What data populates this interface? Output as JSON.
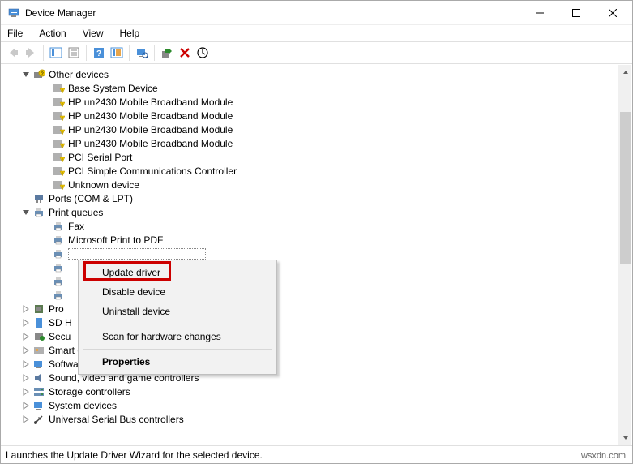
{
  "window": {
    "title": "Device Manager",
    "menus": {
      "file": "File",
      "action": "Action",
      "view": "View",
      "help": "Help"
    }
  },
  "tree": {
    "other_devices": {
      "label": "Other devices",
      "children": {
        "base": "Base System Device",
        "hp1": "HP un2430 Mobile Broadband Module",
        "hp2": "HP un2430 Mobile Broadband Module",
        "hp3": "HP un2430 Mobile Broadband Module",
        "hp4": "HP un2430 Mobile Broadband Module",
        "pci_serial": "PCI Serial Port",
        "pci_comm": "PCI Simple Communications Controller",
        "unknown": "Unknown device"
      }
    },
    "ports": "Ports (COM & LPT)",
    "print_queues": {
      "label": "Print queues",
      "children": {
        "fax": "Fax",
        "pdf": "Microsoft Print to PDF",
        "hidden1": "",
        "hidden2": "",
        "hidden3": "",
        "hidden4": ""
      }
    },
    "processors": "Pro",
    "sd": "SD H",
    "security": "Secu",
    "smart": "Smart card readers",
    "software": "Software devices",
    "sound": "Sound, video and game controllers",
    "storage": "Storage controllers",
    "system": "System devices",
    "usb": "Universal Serial Bus controllers"
  },
  "context_menu": {
    "update": "Update driver",
    "disable": "Disable device",
    "uninstall": "Uninstall device",
    "scan": "Scan for hardware changes",
    "properties": "Properties"
  },
  "status": "Launches the Update Driver Wizard for the selected device.",
  "watermark": "wsxdn.com"
}
